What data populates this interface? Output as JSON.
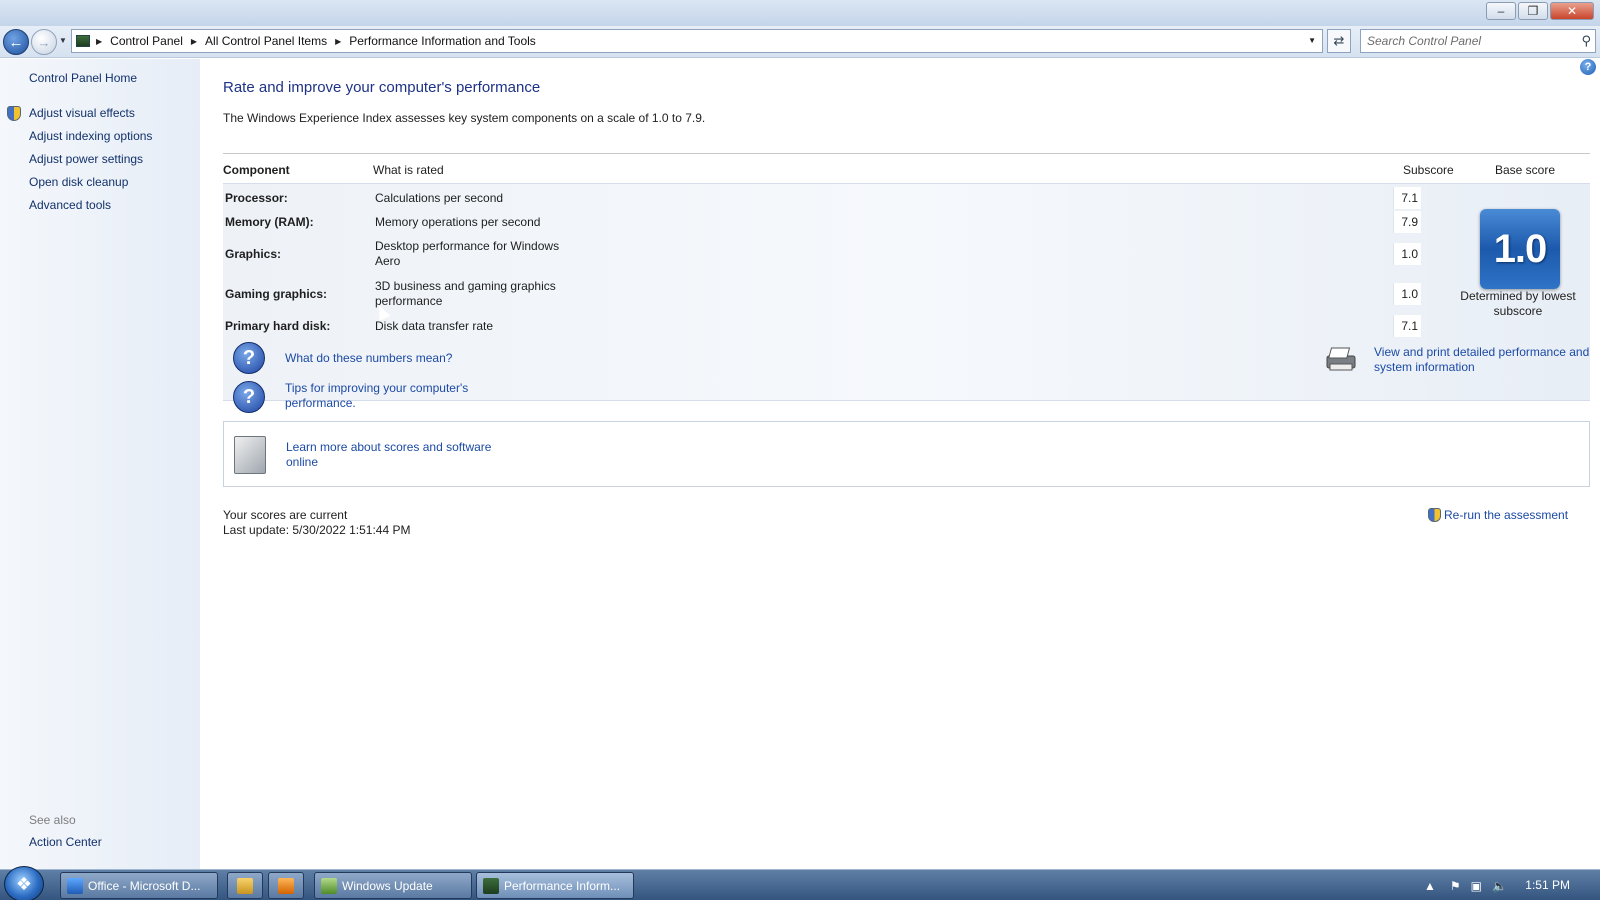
{
  "breadcrumb": {
    "items": [
      "Control Panel",
      "All Control Panel Items",
      "Performance Information and Tools"
    ]
  },
  "search": {
    "placeholder": "Search Control Panel"
  },
  "window_controls": {
    "minimize": "–",
    "restore": "❐",
    "close": "✕"
  },
  "sidebar": {
    "home": "Control Panel Home",
    "links": [
      "Adjust visual effects",
      "Adjust indexing options",
      "Adjust power settings",
      "Open disk cleanup",
      "Advanced tools"
    ],
    "see_also_label": "See also",
    "see_also_links": [
      "Action Center"
    ]
  },
  "main": {
    "title": "Rate and improve your computer's performance",
    "description": "The Windows Experience Index assesses key system components on a scale of 1.0 to 7.9.",
    "columns": {
      "component": "Component",
      "rated": "What is rated",
      "subscore": "Subscore",
      "base": "Base score"
    },
    "rows": [
      {
        "component": "Processor:",
        "rated": "Calculations per second",
        "subscore": "7.1"
      },
      {
        "component": "Memory (RAM):",
        "rated": "Memory operations per second",
        "subscore": "7.9"
      },
      {
        "component": "Graphics:",
        "rated": "Desktop performance for Windows Aero",
        "subscore": "1.0"
      },
      {
        "component": "Gaming graphics:",
        "rated": "3D business and gaming graphics performance",
        "subscore": "1.0"
      },
      {
        "component": "Primary hard disk:",
        "rated": "Disk data transfer rate",
        "subscore": "7.1"
      }
    ],
    "base_score": "1.0",
    "base_note": "Determined by lowest subscore",
    "help_links": [
      "What do these numbers mean?",
      "Tips for improving your computer's performance."
    ],
    "print_link": "View and print detailed performance and system information",
    "learn_link": "Learn more about scores and software online",
    "status_current": "Your scores are current",
    "status_update": "Last update: 5/30/2022 1:51:44 PM",
    "rerun": "Re-run the assessment"
  },
  "taskbar": {
    "items": [
      "Office - Microsoft D...",
      "Windows Update",
      "Performance Inform..."
    ],
    "clock": "1:51 PM"
  },
  "colors": {
    "link": "#1c4aa5",
    "title": "#1e3287",
    "sidebar_link": "#12316b"
  }
}
